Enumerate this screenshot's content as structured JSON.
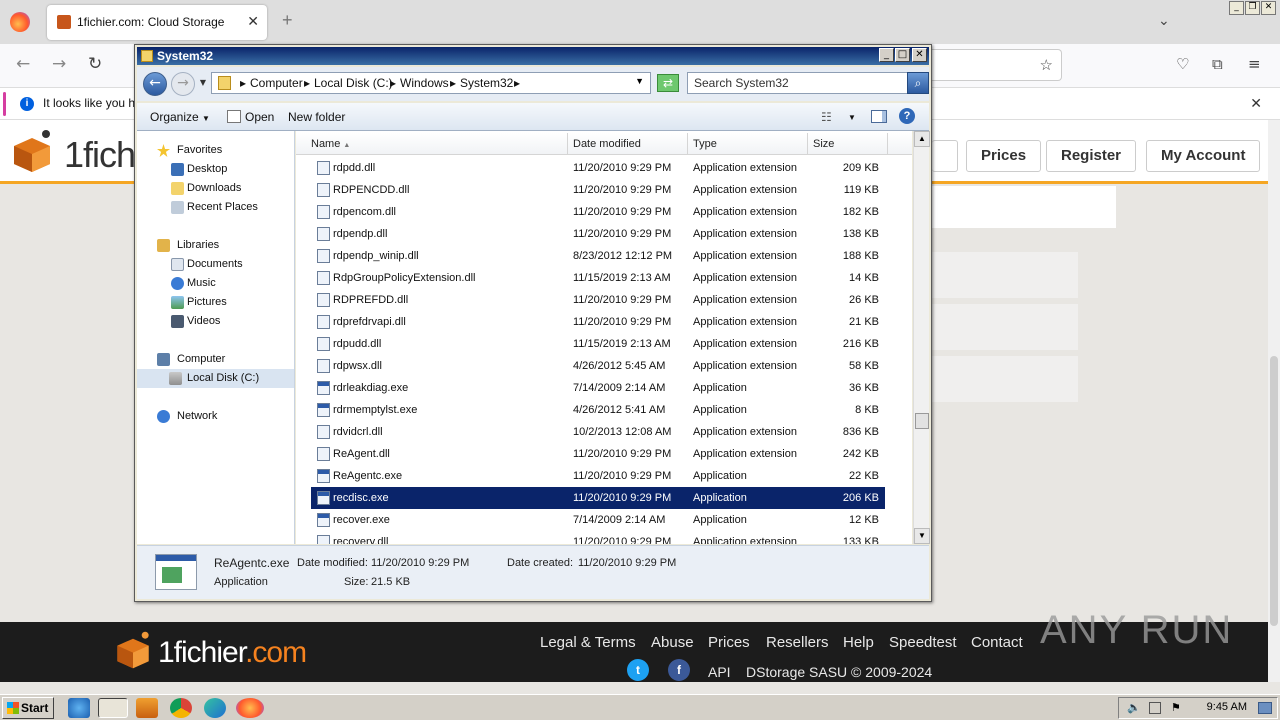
{
  "browser": {
    "tab_title": "1fichier.com: Cloud Storage",
    "notification": "It looks like you ha"
  },
  "site": {
    "logo_text": "1fich",
    "nav": {
      "prices": "Prices",
      "register": "Register",
      "account": "My Account"
    },
    "footer": {
      "brand_a": "1fichier",
      "brand_b": ".com",
      "links": [
        "Legal & Terms",
        "Abuse",
        "Prices",
        "Resellers",
        "Help",
        "Speedtest",
        "Contact"
      ],
      "api": "API",
      "copyright": "DStorage SASU © 2009-2024"
    },
    "watermark": "ANY RUN"
  },
  "explorer": {
    "title": "System32",
    "breadcrumb": [
      "Computer",
      "Local Disk (C:)",
      "Windows",
      "System32"
    ],
    "search_placeholder": "Search System32",
    "toolbar": {
      "organize": "Organize",
      "open": "Open",
      "new_folder": "New folder"
    },
    "nav": {
      "favorites": "Favorites",
      "desktop": "Desktop",
      "downloads": "Downloads",
      "recent": "Recent Places",
      "libraries": "Libraries",
      "documents": "Documents",
      "music": "Music",
      "pictures": "Pictures",
      "videos": "Videos",
      "computer": "Computer",
      "local_disk": "Local Disk (C:)",
      "network": "Network"
    },
    "columns": {
      "name": "Name",
      "date": "Date modified",
      "type": "Type",
      "size": "Size"
    },
    "files": [
      {
        "name": "rdpdd.dll",
        "date": "11/20/2010 9:29 PM",
        "type": "Application extension",
        "size": "209 KB"
      },
      {
        "name": "RDPENCDD.dll",
        "date": "11/20/2010 9:29 PM",
        "type": "Application extension",
        "size": "119 KB"
      },
      {
        "name": "rdpencom.dll",
        "date": "11/20/2010 9:29 PM",
        "type": "Application extension",
        "size": "182 KB"
      },
      {
        "name": "rdpendp.dll",
        "date": "11/20/2010 9:29 PM",
        "type": "Application extension",
        "size": "138 KB"
      },
      {
        "name": "rdpendp_winip.dll",
        "date": "8/23/2012 12:12 PM",
        "type": "Application extension",
        "size": "188 KB"
      },
      {
        "name": "RdpGroupPolicyExtension.dll",
        "date": "11/15/2019 2:13 AM",
        "type": "Application extension",
        "size": "14 KB"
      },
      {
        "name": "RDPREFDD.dll",
        "date": "11/20/2010 9:29 PM",
        "type": "Application extension",
        "size": "26 KB"
      },
      {
        "name": "rdprefdrvapi.dll",
        "date": "11/20/2010 9:29 PM",
        "type": "Application extension",
        "size": "21 KB"
      },
      {
        "name": "rdpudd.dll",
        "date": "11/15/2019 2:13 AM",
        "type": "Application extension",
        "size": "216 KB"
      },
      {
        "name": "rdpwsx.dll",
        "date": "4/26/2012 5:45 AM",
        "type": "Application extension",
        "size": "58 KB"
      },
      {
        "name": "rdrleakdiag.exe",
        "date": "7/14/2009 2:14 AM",
        "type": "Application",
        "size": "36 KB"
      },
      {
        "name": "rdrmemptylst.exe",
        "date": "4/26/2012 5:41 AM",
        "type": "Application",
        "size": "8 KB"
      },
      {
        "name": "rdvidcrl.dll",
        "date": "10/2/2013 12:08 AM",
        "type": "Application extension",
        "size": "836 KB"
      },
      {
        "name": "ReAgent.dll",
        "date": "11/20/2010 9:29 PM",
        "type": "Application extension",
        "size": "242 KB"
      },
      {
        "name": "ReAgentc.exe",
        "date": "11/20/2010 9:29 PM",
        "type": "Application",
        "size": "22 KB"
      },
      {
        "name": "recdisc.exe",
        "date": "11/20/2010 9:29 PM",
        "type": "Application",
        "size": "206 KB"
      },
      {
        "name": "recover.exe",
        "date": "7/14/2009 2:14 AM",
        "type": "Application",
        "size": "12 KB"
      },
      {
        "name": "recovery.dll",
        "date": "11/20/2010 9:29 PM",
        "type": "Application extension",
        "size": "133 KB"
      }
    ],
    "selected_index": 15,
    "details": {
      "filename": "ReAgentc.exe",
      "type": "Application",
      "modified_label": "Date modified:",
      "modified": "11/20/2010 9:29 PM",
      "created_label": "Date created:",
      "created": "11/20/2010 9:29 PM",
      "size_label": "Size:",
      "size": "21.5 KB"
    }
  },
  "taskbar": {
    "start": "Start",
    "clock": "9:45 AM"
  },
  "colors": {
    "accent_orange": "#f5821f",
    "selection": "#0a246a",
    "footer_bg": "#1c1c1c"
  }
}
